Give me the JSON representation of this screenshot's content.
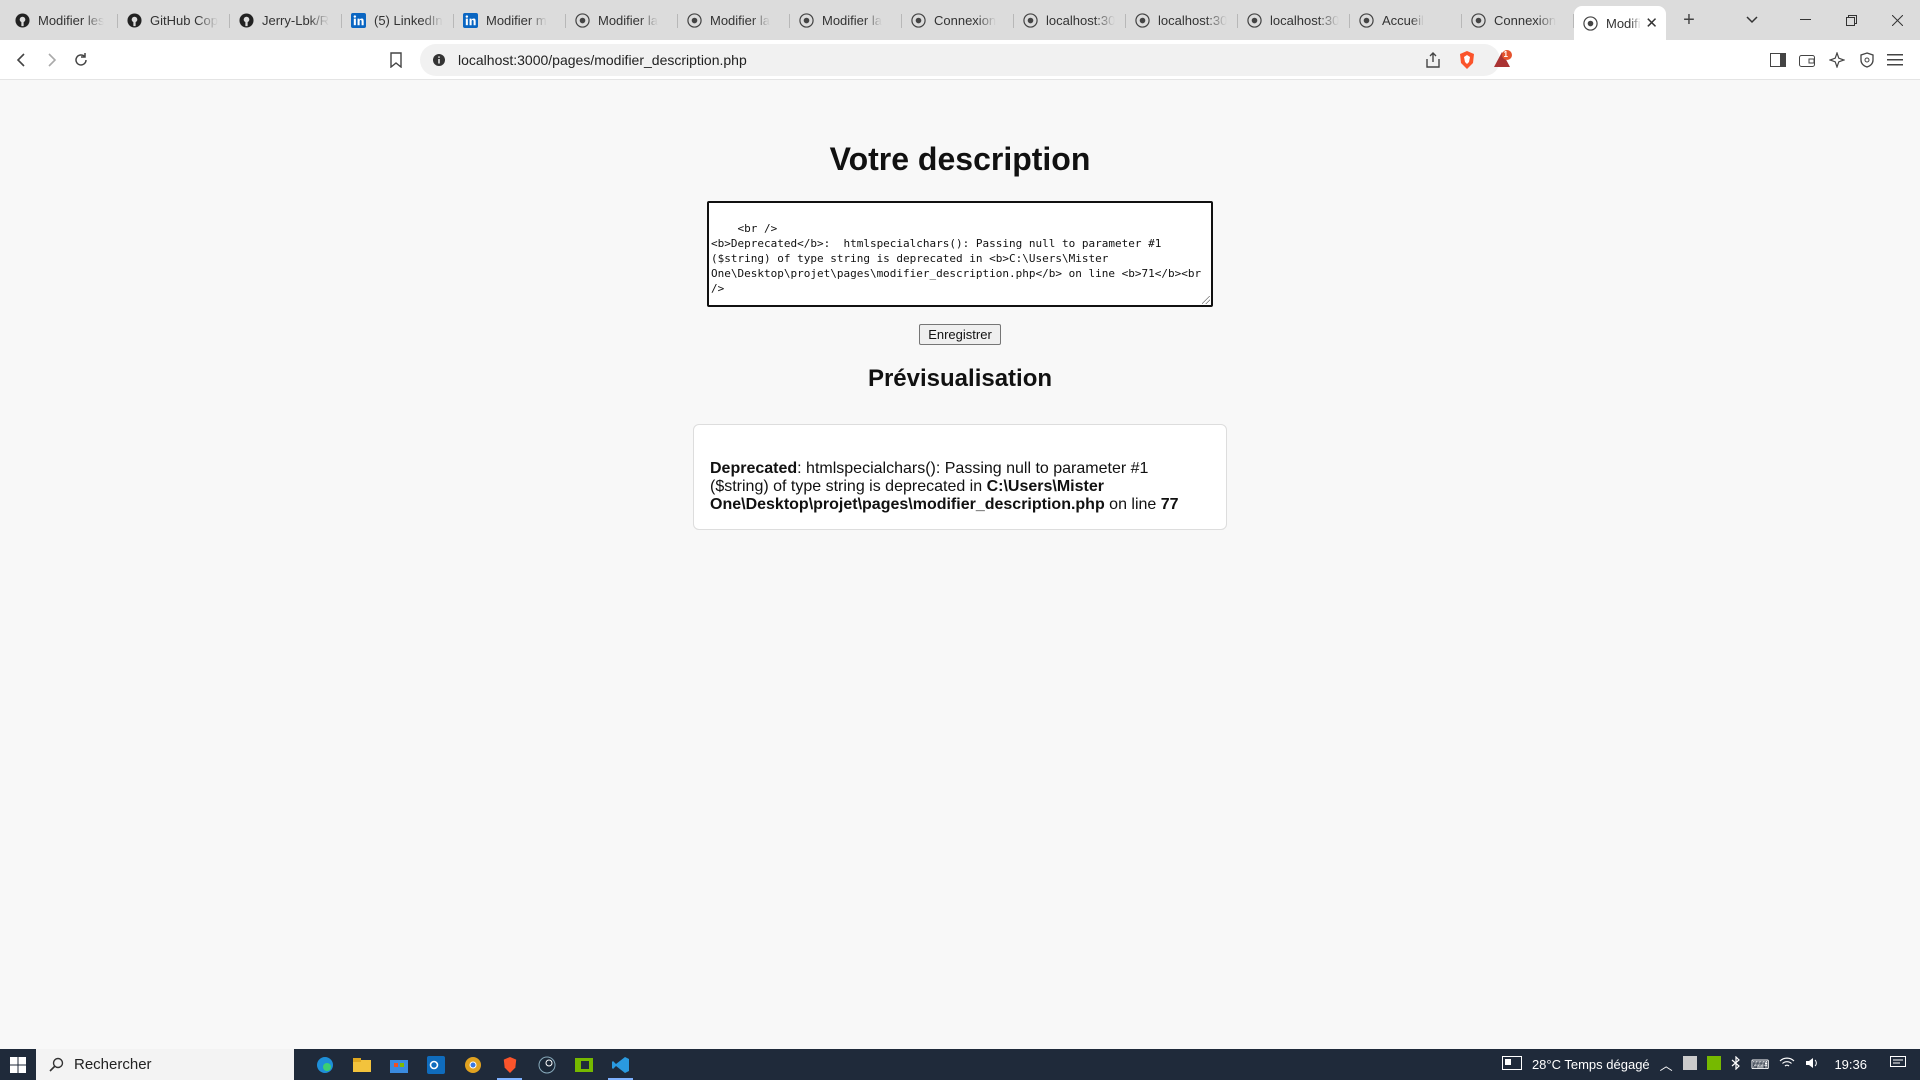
{
  "browser": {
    "tabs": [
      {
        "label": "Modifier les",
        "icon": "github-icon"
      },
      {
        "label": "GitHub Cop",
        "icon": "github-icon"
      },
      {
        "label": "Jerry-Lbk/R",
        "icon": "github-icon"
      },
      {
        "label": "(5) LinkedIn",
        "icon": "linkedin-icon"
      },
      {
        "label": "Modifier m",
        "icon": "linkedin-icon"
      },
      {
        "label": "Modifier la",
        "icon": "globe-icon"
      },
      {
        "label": "Modifier la",
        "icon": "globe-icon"
      },
      {
        "label": "Modifier la",
        "icon": "globe-icon"
      },
      {
        "label": "Connexion",
        "icon": "globe-icon"
      },
      {
        "label": "localhost:30",
        "icon": "globe-icon"
      },
      {
        "label": "localhost:30",
        "icon": "globe-icon"
      },
      {
        "label": "localhost:30",
        "icon": "globe-icon"
      },
      {
        "label": "Accueil",
        "icon": "globe-icon"
      },
      {
        "label": "Connexion",
        "icon": "globe-icon"
      },
      {
        "label": "Modifi",
        "icon": "globe-icon",
        "active": true
      }
    ],
    "new_tab": "+",
    "url": "localhost:3000/pages/modifier_description.php",
    "notification_count": "1",
    "brand_color": "#fb542b"
  },
  "page": {
    "title": "Votre description",
    "textarea_value": "<br />\n<b>Deprecated</b>:  htmlspecialchars(): Passing null to parameter #1 ($string) of type string is deprecated in <b>C:\\Users\\Mister One\\Desktop\\projet\\pages\\modifier_description.php</b> on line <b>71</b><br />",
    "save_label": "Enregistrer",
    "preview_title": "Prévisualisation",
    "preview": {
      "deprecated": "Deprecated",
      "message": ": htmlspecialchars(): Passing null to parameter #1 ($string) of type string is deprecated in ",
      "path": "C:\\Users\\Mister One\\Desktop\\projet\\pages\\modifier_description.php",
      "on_line": " on line ",
      "line": "77"
    }
  },
  "taskbar": {
    "search_placeholder": "Rechercher",
    "weather": "28°C  Temps dégagé",
    "time": "19:36"
  }
}
